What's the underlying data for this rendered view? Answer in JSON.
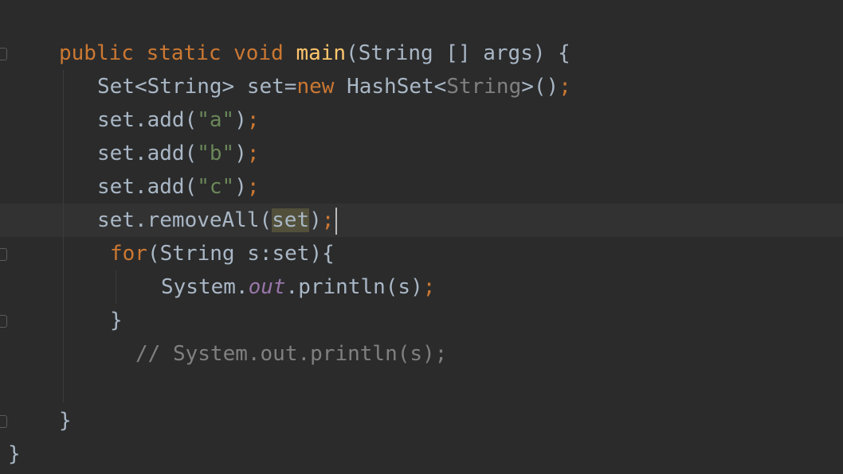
{
  "code": {
    "line1": {
      "kw_public": "public",
      "kw_static": "static",
      "kw_void": "void",
      "method": "main",
      "rest": "(String [] args) {"
    },
    "line2": {
      "decl": "Set<String> set=",
      "kw_new": "new",
      "type": " HashSet<",
      "generic": "String",
      "close": ">()",
      "semi": ";"
    },
    "line3": {
      "pre": "set.add(",
      "str": "\"a\"",
      "post": ")",
      "semi": ";"
    },
    "line4": {
      "pre": "set.add(",
      "str": "\"b\"",
      "post": ")",
      "semi": ";"
    },
    "line5": {
      "pre": "set.add(",
      "str": "\"c\"",
      "post": ")",
      "semi": ";"
    },
    "line6": {
      "pre": "set.removeAll(",
      "arg": "set",
      "post": ")",
      "semi": ";"
    },
    "line7": {
      "kw_for": "for",
      "rest": "(String s:set){"
    },
    "line8": {
      "pre": "System.",
      "field": "out",
      "post": ".println(s)",
      "semi": ";"
    },
    "line9": {
      "text": "}"
    },
    "line10": {
      "text": "// System.out.println(s);"
    },
    "line11": {
      "text": "}"
    },
    "line12": {
      "text": "}"
    }
  },
  "colors": {
    "background": "#2b2b2b",
    "keyword": "#cc7832",
    "method": "#ffc66d",
    "string": "#6a8759",
    "default": "#a9b7c6",
    "comment": "#808080",
    "field": "#9876aa"
  }
}
